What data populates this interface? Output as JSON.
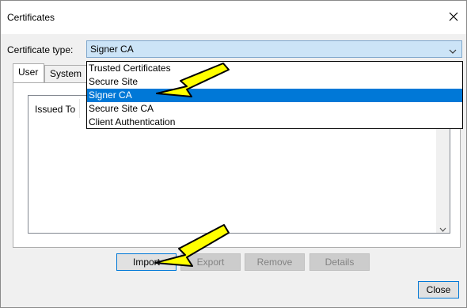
{
  "window": {
    "title": "Certificates"
  },
  "certificate_type": {
    "label": "Certificate type:",
    "selected": "Signer CA",
    "options": [
      "Trusted Certificates",
      "Secure Site",
      "Signer CA",
      "Secure Site CA",
      "Client Authentication"
    ],
    "selected_index": 2
  },
  "tabs": [
    {
      "label": "User",
      "active": true
    },
    {
      "label": "System",
      "active": false
    }
  ],
  "list": {
    "column_header": "Issued To"
  },
  "buttons": {
    "import": "Import",
    "export": "Export",
    "remove": "Remove",
    "details": "Details",
    "close": "Close"
  },
  "colors": {
    "selection": "#0078d7",
    "combo_bg": "#cce4f7",
    "annotation_arrow": "#ffff00"
  },
  "icons": {
    "close": "close-icon",
    "dropdown": "chevron-down-icon",
    "scroll_down": "scroll-down-icon",
    "annotation": "annotation-arrow-icon"
  }
}
